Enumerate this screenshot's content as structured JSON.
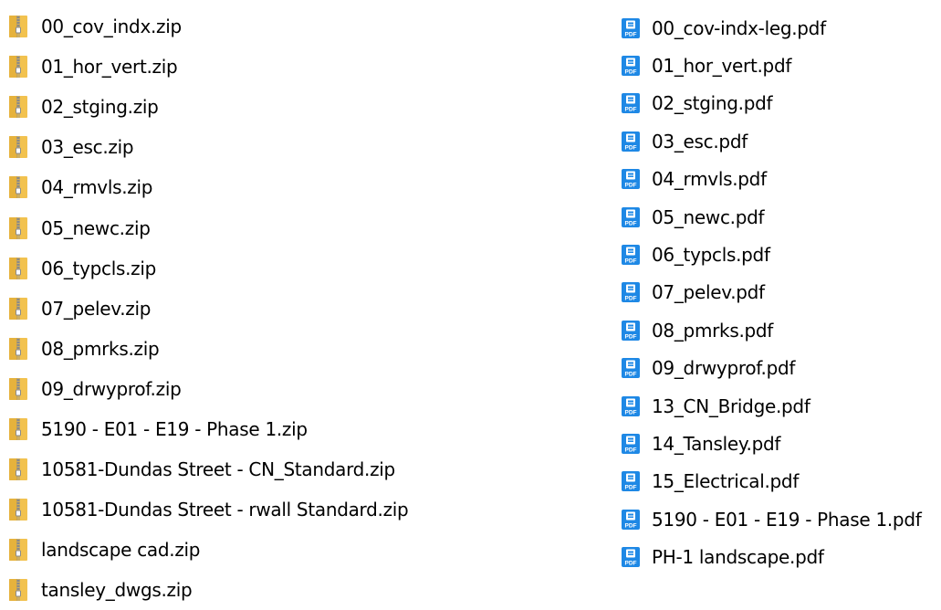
{
  "icons": {
    "zip": "zip-folder-icon",
    "pdf": "pdf-file-icon"
  },
  "colors": {
    "folder_body": "#F2C24F",
    "folder_tab": "#DDA52E",
    "zipper": "#8A8A8A",
    "pdf_blue": "#1E88E5"
  },
  "zip_files": [
    {
      "name": "00_cov_indx.zip"
    },
    {
      "name": "01_hor_vert.zip"
    },
    {
      "name": "02_stging.zip"
    },
    {
      "name": "03_esc.zip"
    },
    {
      "name": "04_rmvls.zip"
    },
    {
      "name": "05_newc.zip"
    },
    {
      "name": "06_typcls.zip"
    },
    {
      "name": "07_pelev.zip"
    },
    {
      "name": "08_pmrks.zip"
    },
    {
      "name": "09_drwyprof.zip"
    },
    {
      "name": "5190 - E01 - E19 - Phase 1.zip"
    },
    {
      "name": "10581-Dundas Street - CN_Standard.zip"
    },
    {
      "name": "10581-Dundas Street - rwall Standard.zip"
    },
    {
      "name": "landscape cad.zip"
    },
    {
      "name": "tansley_dwgs.zip"
    }
  ],
  "pdf_files": [
    {
      "name": "00_cov-indx-leg.pdf"
    },
    {
      "name": "01_hor_vert.pdf"
    },
    {
      "name": "02_stging.pdf"
    },
    {
      "name": "03_esc.pdf"
    },
    {
      "name": "04_rmvls.pdf"
    },
    {
      "name": "05_newc.pdf"
    },
    {
      "name": "06_typcls.pdf"
    },
    {
      "name": "07_pelev.pdf"
    },
    {
      "name": "08_pmrks.pdf"
    },
    {
      "name": "09_drwyprof.pdf"
    },
    {
      "name": "13_CN_Bridge.pdf"
    },
    {
      "name": "14_Tansley.pdf"
    },
    {
      "name": "15_Electrical.pdf"
    },
    {
      "name": "5190 - E01 - E19 - Phase 1.pdf"
    },
    {
      "name": "PH-1 landscape.pdf"
    }
  ]
}
